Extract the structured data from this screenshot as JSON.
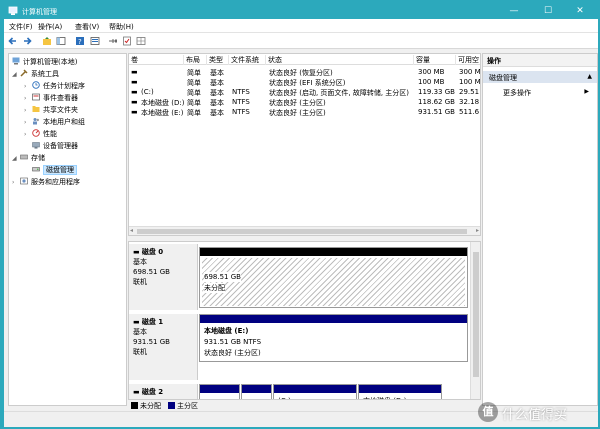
{
  "window": {
    "title": "计算机管理"
  },
  "menu": [
    "文件(F)",
    "操作(A)",
    "查看(V)",
    "帮助(H)"
  ],
  "tree": {
    "root": "计算机管理(本地)",
    "system_tools": "系统工具",
    "task_scheduler": "任务计划程序",
    "event_viewer": "事件查看器",
    "shared_folders": "共享文件夹",
    "local_users": "本地用户和组",
    "performance": "性能",
    "device_manager": "设备管理器",
    "storage": "存储",
    "disk_management": "磁盘管理",
    "services": "服务和应用程序"
  },
  "volume_table": {
    "columns": [
      "卷",
      "布局",
      "类型",
      "文件系统",
      "状态",
      "容量",
      "可用空"
    ],
    "rows": [
      {
        "vol": "",
        "layout": "简单",
        "type": "基本",
        "fs": "",
        "status": "状态良好 (恢复分区)",
        "capacity": "300 MB",
        "free": "300 MB"
      },
      {
        "vol": "",
        "layout": "简单",
        "type": "基本",
        "fs": "",
        "status": "状态良好 (EFI 系统分区)",
        "capacity": "100 MB",
        "free": "100 MB"
      },
      {
        "vol": "(C:)",
        "layout": "简单",
        "type": "基本",
        "fs": "NTFS",
        "status": "状态良好 (启动, 页面文件, 故障转储, 主分区)",
        "capacity": "119.33 GB",
        "free": "29.51"
      },
      {
        "vol": "本地磁盘 (D:)",
        "layout": "简单",
        "type": "基本",
        "fs": "NTFS",
        "status": "状态良好 (主分区)",
        "capacity": "118.62 GB",
        "free": "32.18"
      },
      {
        "vol": "本地磁盘 (E:)",
        "layout": "简单",
        "type": "基本",
        "fs": "NTFS",
        "status": "状态良好 (主分区)",
        "capacity": "931.51 GB",
        "free": "511.6"
      }
    ]
  },
  "disks": [
    {
      "name": "磁盘 0",
      "type": "基本",
      "size": "698.51 GB",
      "state": "联机",
      "part_size": "698.51 GB",
      "part_status": "未分配"
    },
    {
      "name": "磁盘 1",
      "type": "基本",
      "size": "931.51 GB",
      "state": "联机",
      "part_name": "本地磁盘 (E:)",
      "part_size": "931.51 GB NTFS",
      "part_status": "状态良好 (主分区)"
    },
    {
      "name": "磁盘 2",
      "part_c": "(C:)",
      "part_d": "本地磁盘 (D:)"
    }
  ],
  "legend": {
    "unallocated": "未分配",
    "primary": "主分区"
  },
  "actions": {
    "header": "操作",
    "section": "磁盘管理",
    "more": "更多操作"
  },
  "watermark": {
    "icon": "值",
    "text": "什么值得买"
  },
  "colors": {
    "accent": "#2ca9bc",
    "primary_partition": "#000080",
    "unallocated": "#000000"
  }
}
